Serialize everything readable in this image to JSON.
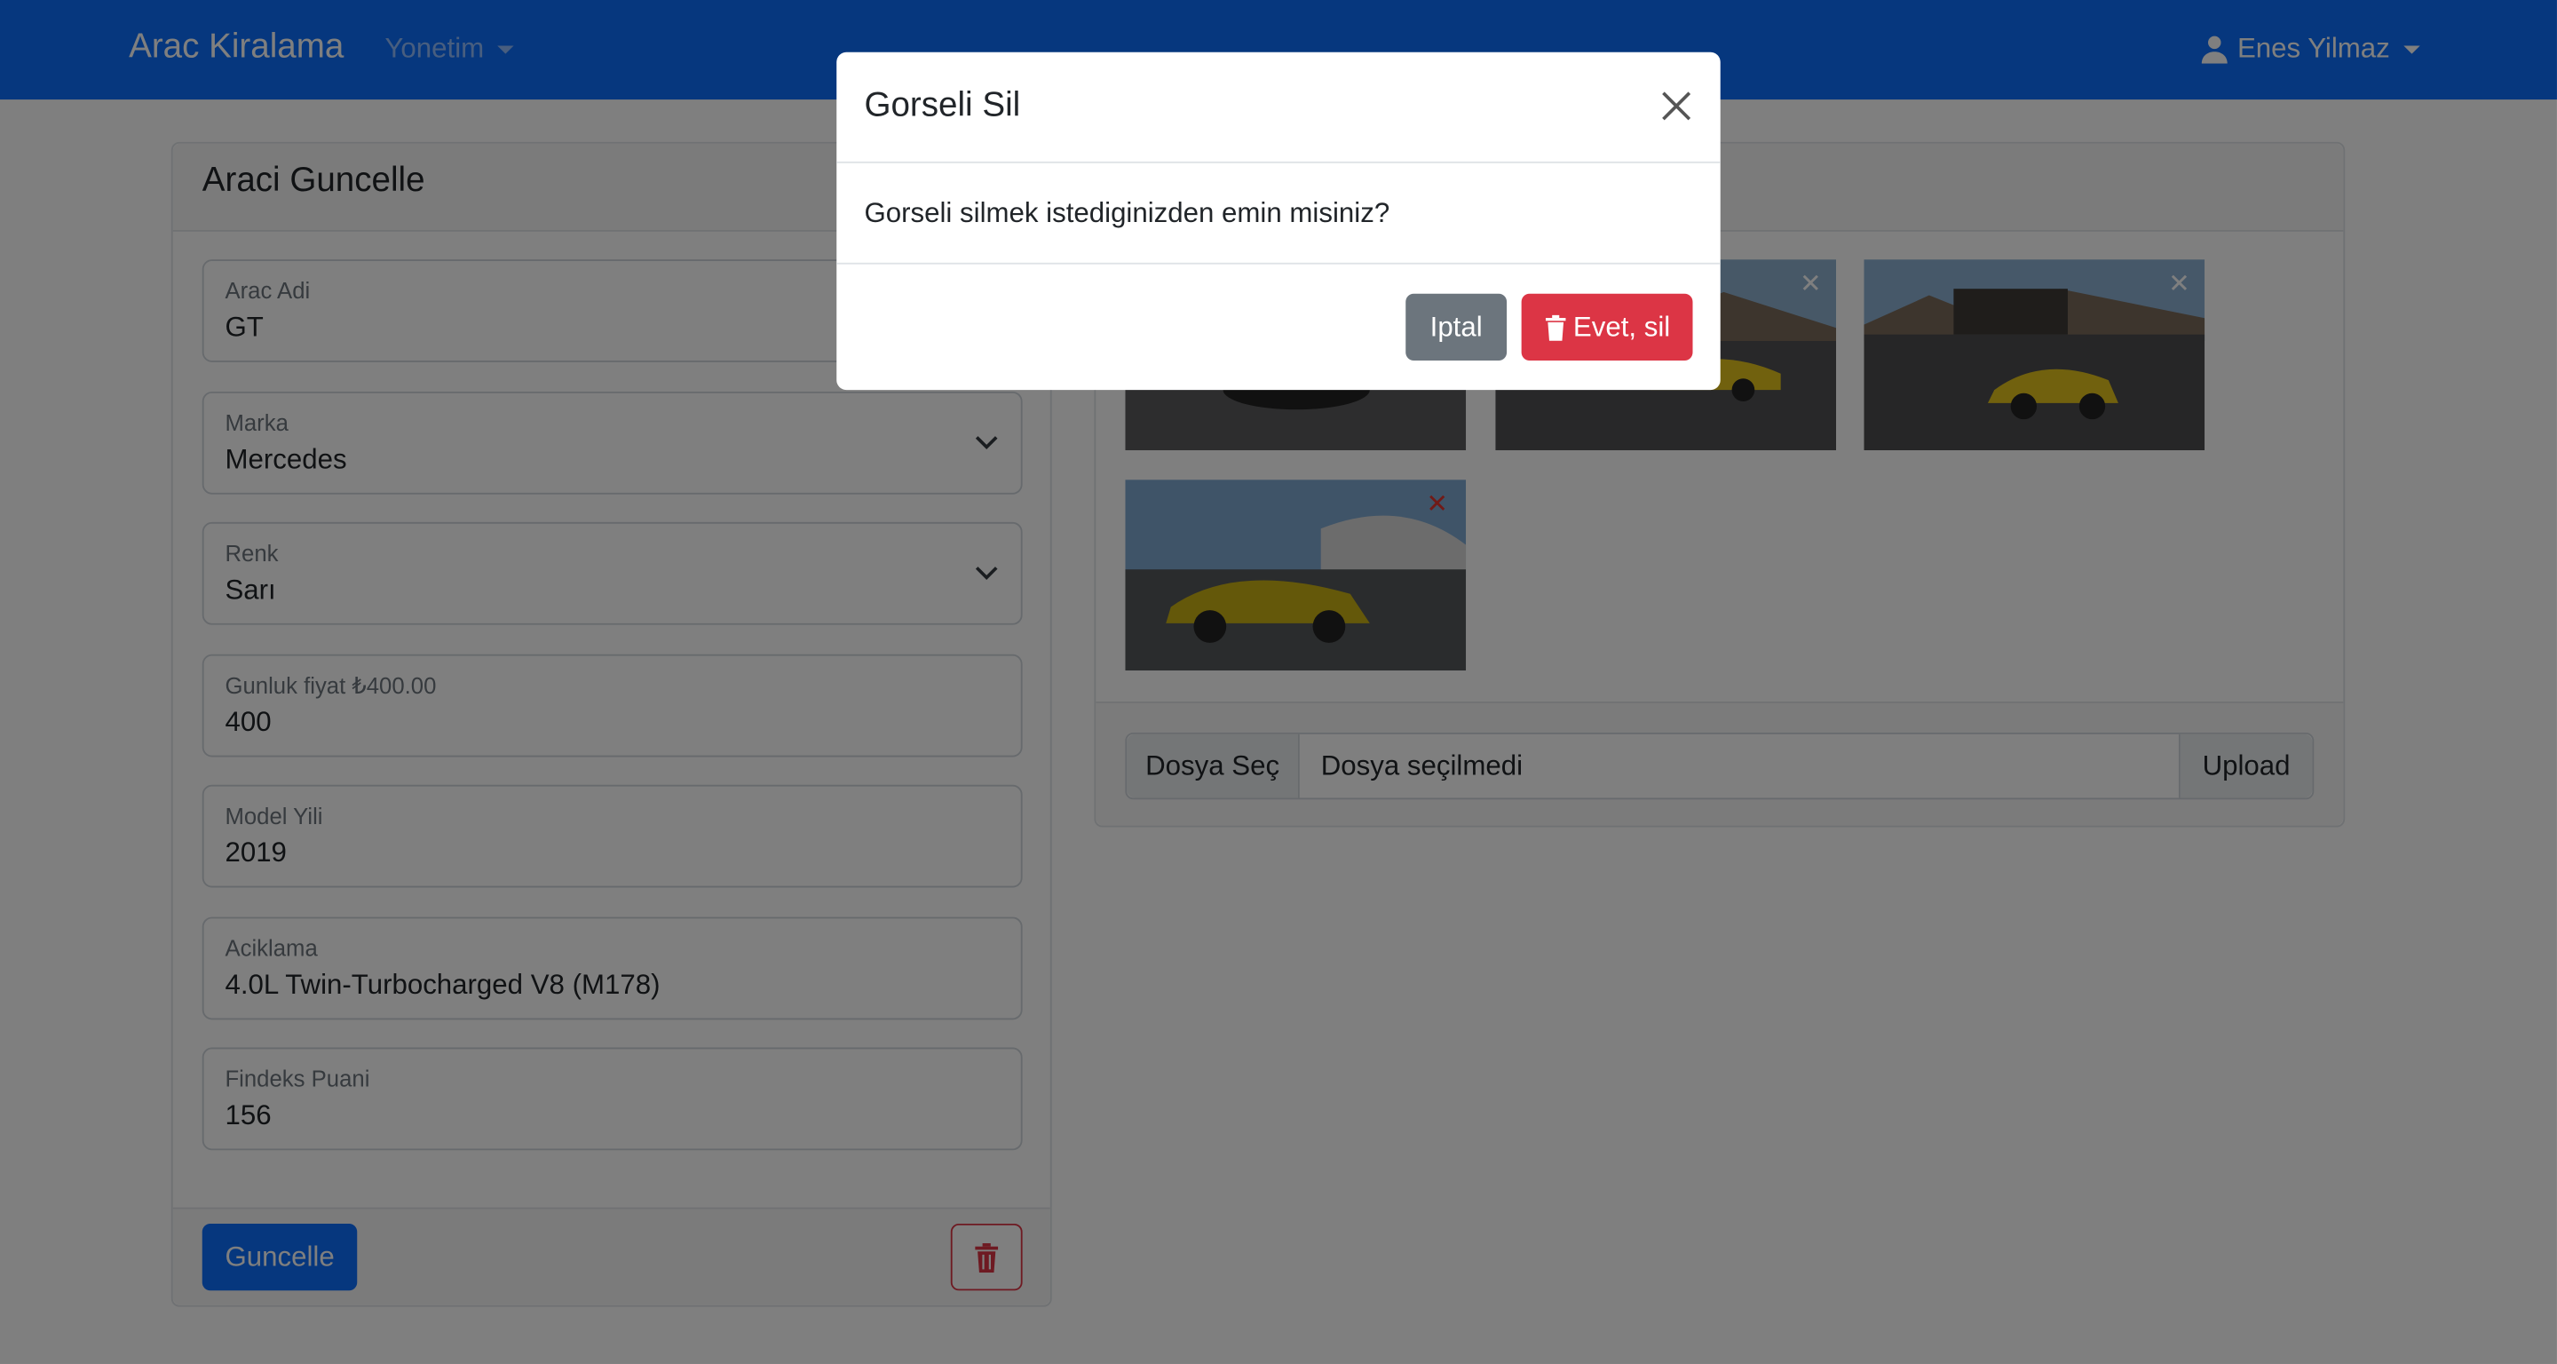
{
  "navbar": {
    "brand": "Arac Kiralama",
    "menu_label": "Yonetim",
    "user_name": "Enes Yilmaz"
  },
  "update_card": {
    "title": "Araci Guncelle",
    "fields": [
      {
        "label": "Arac Adi",
        "value": "GT",
        "type": "input"
      },
      {
        "label": "Marka",
        "value": "Mercedes",
        "type": "select"
      },
      {
        "label": "Renk",
        "value": "Sarı",
        "type": "select"
      },
      {
        "label": "Gunluk fiyat ₺400.00",
        "value": "400",
        "type": "input"
      },
      {
        "label": "Model Yili",
        "value": "2019",
        "type": "input"
      },
      {
        "label": "Aciklama",
        "value": "4.0L Twin-Turbocharged V8 (M178)",
        "type": "input"
      },
      {
        "label": "Findeks Puani",
        "value": "156",
        "type": "input"
      }
    ],
    "update_button": "Guncelle",
    "delete_icon": "trash-icon"
  },
  "gallery": {
    "images": [
      {
        "remove_icon": "close-icon"
      },
      {
        "remove_icon": "close-icon"
      },
      {
        "remove_icon": "close-icon"
      },
      {
        "remove_icon": "close-icon"
      }
    ],
    "file_button": "Dosya Seç",
    "file_status": "Dosya seçilmedi",
    "upload_button": "Upload"
  },
  "modal": {
    "title": "Gorseli Sil",
    "body": "Gorseli silmek istediginizden emin misiniz?",
    "cancel_button": "Iptal",
    "confirm_button": "Evet, sil",
    "close_icon": "close-icon"
  },
  "colors": {
    "primary": "#0d6efd",
    "danger": "#dc3545",
    "secondary": "#6c757d"
  }
}
